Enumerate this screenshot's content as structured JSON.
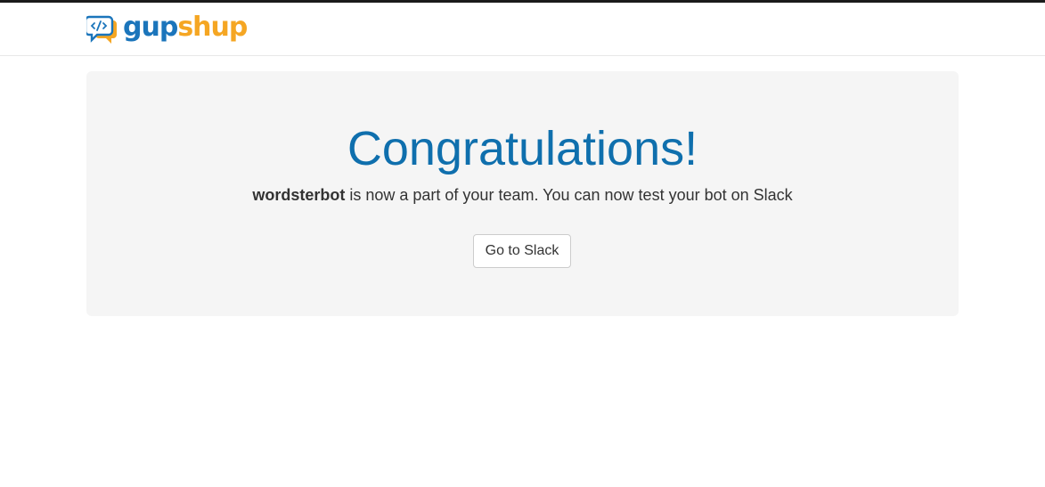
{
  "brand": {
    "name_part1": "gup",
    "name_part2": "shup",
    "icon": "code-chat-bubble-icon",
    "colors": {
      "primary": "#1b75bb",
      "accent": "#f5a623"
    }
  },
  "main": {
    "headline": "Congratulations!",
    "bot_name": "wordsterbot",
    "message": " is now a part of your team. You can now test your bot on Slack",
    "button_label": "Go to Slack"
  }
}
